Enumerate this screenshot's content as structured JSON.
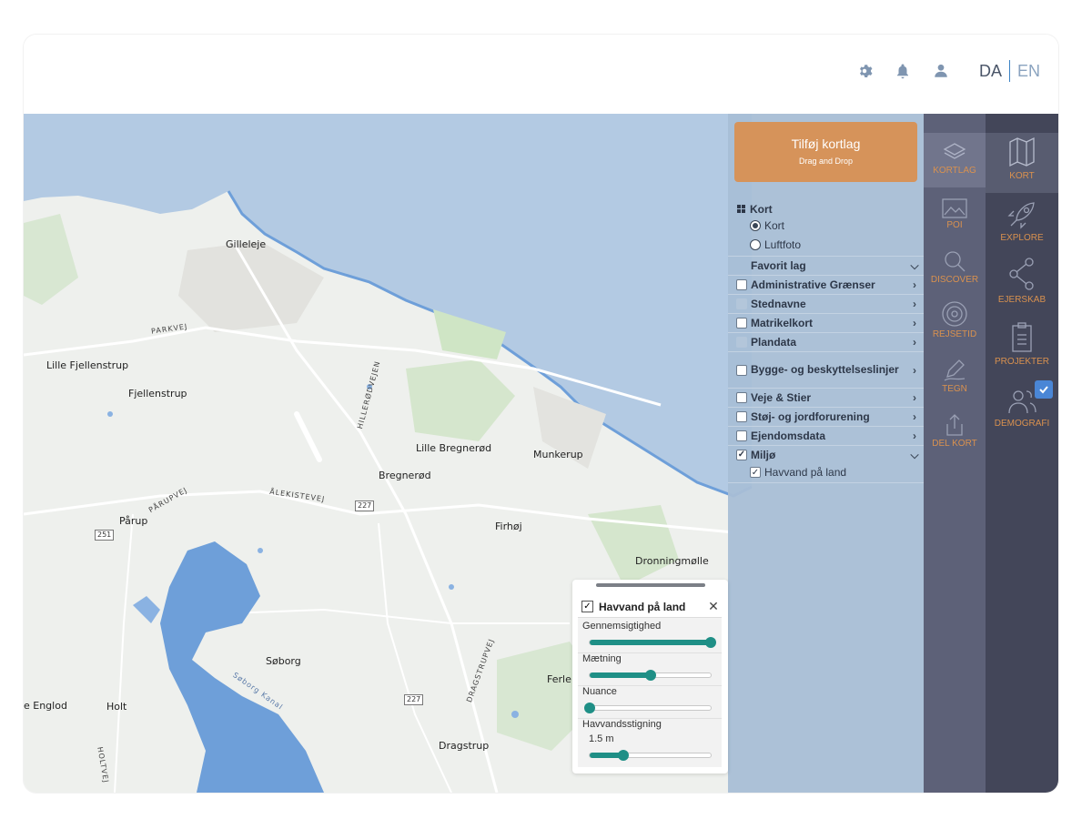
{
  "header": {
    "lang_da": "DA",
    "lang_en": "EN",
    "icons": [
      "gear-icon",
      "bell-icon",
      "user-icon"
    ]
  },
  "map": {
    "places": [
      {
        "name": "Gilleleje"
      },
      {
        "name": "Lille Fjellenstrup"
      },
      {
        "name": "Fjellenstrup"
      },
      {
        "name": "Lille Bregnerød"
      },
      {
        "name": "Bregnerød"
      },
      {
        "name": "Munkerup"
      },
      {
        "name": "Pårup"
      },
      {
        "name": "Firhøj"
      },
      {
        "name": "Dronningmølle"
      },
      {
        "name": "Søborg"
      },
      {
        "name": "Ferle"
      },
      {
        "name": "Holt"
      },
      {
        "name": "e Englod"
      },
      {
        "name": "Dragstrup"
      }
    ],
    "roads": [
      "PARKVEJ",
      "HILLERØDVEJEN",
      "ÅLEKISTEVEJ",
      "PÅRUPVEJ",
      "DRAGSTRUPVEJ",
      "HOLTVEJ",
      "Søborg Kanal"
    ],
    "shields": [
      "227",
      "251",
      "227"
    ]
  },
  "layer_panel": {
    "add_button_title": "Tilføj kortlag",
    "add_button_subtitle": "Drag and Drop",
    "kort_heading": "Kort",
    "basemaps": [
      {
        "label": "Kort",
        "selected": true
      },
      {
        "label": "Luftfoto",
        "selected": false
      }
    ],
    "groups": [
      {
        "label": "Favorit lag",
        "checkbox": "none",
        "expanded": true
      },
      {
        "label": "Administrative Grænser",
        "checkbox": "empty",
        "expanded": false
      },
      {
        "label": "Stednavne",
        "checkbox": "dim",
        "expanded": false
      },
      {
        "label": "Matrikelkort",
        "checkbox": "empty",
        "expanded": false
      },
      {
        "label": "Plandata",
        "checkbox": "dim",
        "expanded": false
      },
      {
        "label": "Bygge- og beskyttelseslinjer",
        "checkbox": "empty",
        "expanded": false
      },
      {
        "label": "Veje & Stier",
        "checkbox": "empty",
        "expanded": false
      },
      {
        "label": "Støj- og jordforurening",
        "checkbox": "empty",
        "expanded": false
      },
      {
        "label": "Ejendomsdata",
        "checkbox": "empty",
        "expanded": false
      },
      {
        "label": "Miljø",
        "checkbox": "checked",
        "expanded": true
      }
    ],
    "miljo_sublayer": {
      "label": "Havvand på land",
      "checked": true
    }
  },
  "tools": [
    {
      "label": "KORTLAG",
      "icon": "layers-icon",
      "active": true
    },
    {
      "label": "POI",
      "icon": "image-icon",
      "active": false
    },
    {
      "label": "DISCOVER",
      "icon": "search-icon",
      "active": false
    },
    {
      "label": "REJSETID",
      "icon": "target-icon",
      "active": false
    },
    {
      "label": "TEGN",
      "icon": "pencil-icon",
      "active": false
    },
    {
      "label": "DEL KORT",
      "icon": "share-upload-icon",
      "active": false
    }
  ],
  "nav": [
    {
      "label": "KORT",
      "icon": "map-icon",
      "active": true
    },
    {
      "label": "EXPLORE",
      "icon": "rocket-icon",
      "active": false
    },
    {
      "label": "EJERSKAB",
      "icon": "share-nodes-icon",
      "active": false
    },
    {
      "label": "PROJEKTER",
      "icon": "clipboard-icon",
      "active": false
    },
    {
      "label": "DEMOGRAFI",
      "icon": "people-icon",
      "active": false
    }
  ],
  "layer_card": {
    "title": "Havvand på land",
    "checked": true,
    "sliders": [
      {
        "label": "Gennemsigtighed",
        "value": 1.0
      },
      {
        "label": "Mætning",
        "value": 0.5
      },
      {
        "label": "Nuance",
        "value": 0.0
      },
      {
        "label": "Havvandsstigning",
        "value": 0.28,
        "value_text": "1.5 m"
      }
    ]
  },
  "colors": {
    "accent_orange": "#d6935a",
    "slider_teal": "#1f8f86",
    "nav_dark": "#434659",
    "tool_col": "#5d6178",
    "sea": "#b3cae3",
    "lake": "#6e9fd9"
  }
}
